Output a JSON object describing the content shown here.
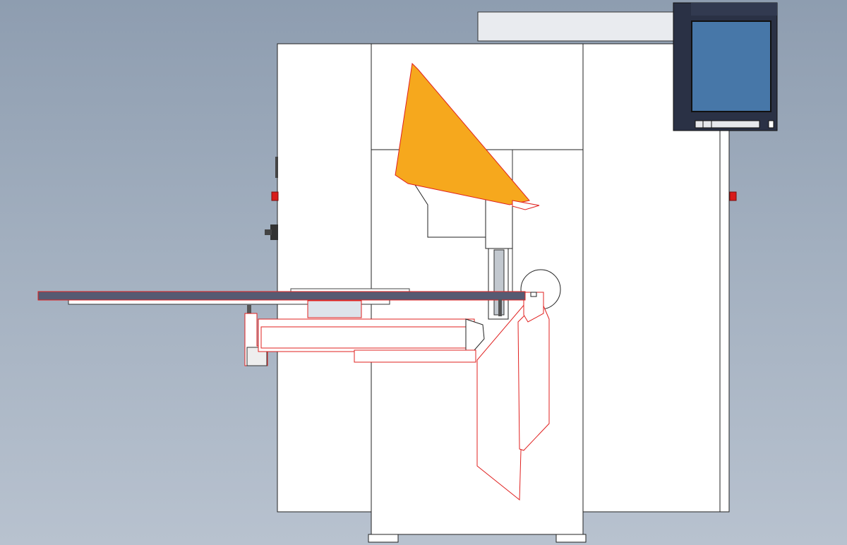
{
  "view": "machine-cad-side-elevation",
  "colors": {
    "background_top": "#8e9db0",
    "background_bottom": "#b8c2cf",
    "panel_fill": "#ffffff",
    "outline": "#222222",
    "highlight_outline": "#e0201f",
    "cover_fill": "#f6a81d",
    "table_bar": "#565a72",
    "screen_frame": "#2a3145",
    "screen_fill": "#4777a8",
    "button_red": "#d81b1b"
  },
  "icons": {
    "emergency_stop_left": "red-stop-button-icon",
    "emergency_stop_right": "red-stop-button-icon",
    "knob": "rotary-knob-icon"
  }
}
